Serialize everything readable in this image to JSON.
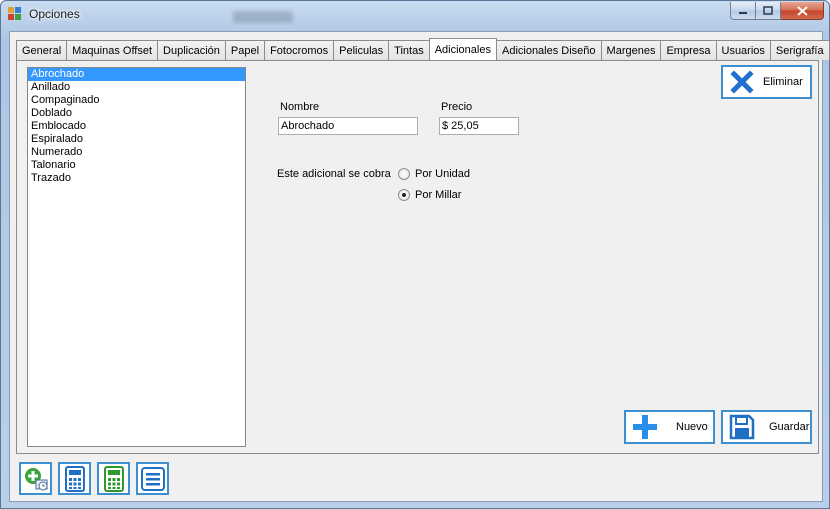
{
  "window": {
    "title": "Opciones"
  },
  "tabs": [
    {
      "label": "General"
    },
    {
      "label": "Maquinas Offset"
    },
    {
      "label": "Duplicación"
    },
    {
      "label": "Papel"
    },
    {
      "label": "Fotocromos"
    },
    {
      "label": "Peliculas"
    },
    {
      "label": "Tintas"
    },
    {
      "label": "Adicionales",
      "active": true
    },
    {
      "label": "Adicionales Diseño"
    },
    {
      "label": "Margenes"
    },
    {
      "label": "Empresa"
    },
    {
      "label": "Usuarios"
    },
    {
      "label": "Serigrafía"
    }
  ],
  "list": {
    "items": [
      "Abrochado",
      "Anillado",
      "Compaginado",
      "Doblado",
      "Emblocado",
      "Espiralado",
      "Numerado",
      "Talonario",
      "Trazado"
    ],
    "selected_index": 0
  },
  "form": {
    "name_label": "Nombre",
    "name_value": "Abrochado",
    "price_label": "Precio",
    "price_value": "$ 25,05",
    "charge_label": "Este adicional se cobra",
    "option_unit": "Por Unidad",
    "option_thousand": "Por Millar",
    "selected_option": "Por Millar"
  },
  "buttons": {
    "delete_label": "Eliminar",
    "new_label": "Nuevo",
    "save_label": "Guardar"
  },
  "toolbar_icons": [
    "add-schedule-icon",
    "calculator-icon",
    "calculator-green-icon",
    "list-icon"
  ],
  "colors": {
    "accent_border": "#3d8fd0",
    "selection": "#3399ff",
    "delete_icon": "#1e6fd0",
    "new_icon": "#2a8ee8",
    "save_icon": "#1f6fc4",
    "calc_green": "#2e9a2e"
  }
}
